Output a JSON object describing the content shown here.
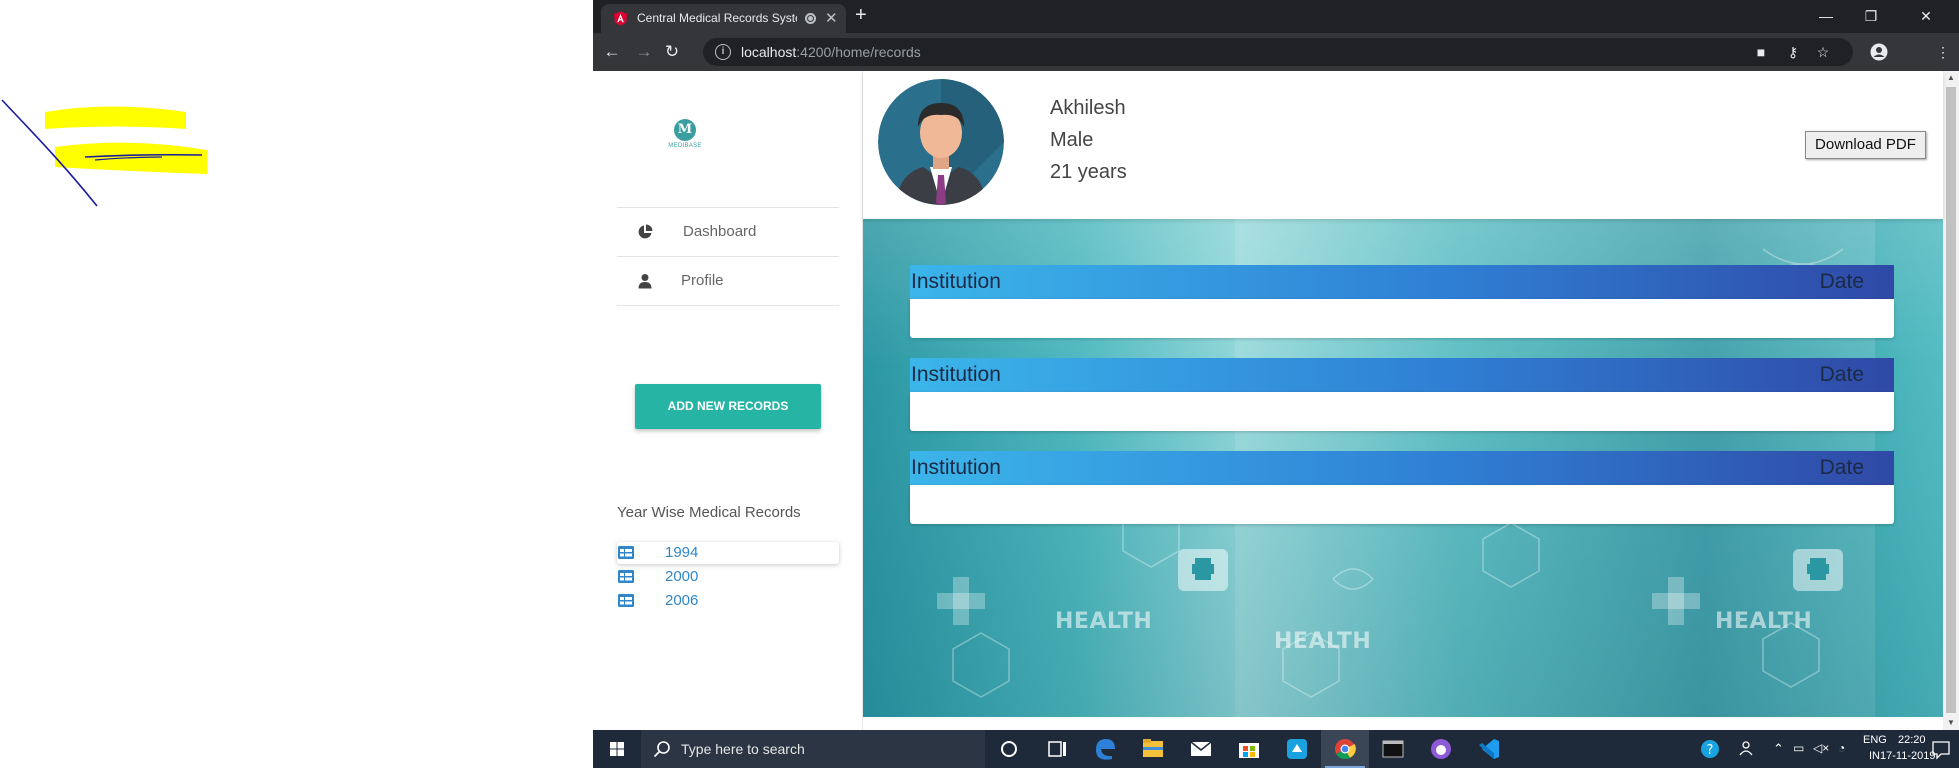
{
  "browser": {
    "tab_title": "Central Medical Records System",
    "url_host": "localhost",
    "url_path": ":4200/home/records"
  },
  "sidebar": {
    "logo_letter": "M",
    "logo_text": "MEDIBASE",
    "nav": [
      {
        "label": "Dashboard",
        "icon": "pie-chart-icon"
      },
      {
        "label": "Profile",
        "icon": "user-icon"
      }
    ],
    "add_button": "ADD NEW RECORDS",
    "years_heading": "Year Wise Medical Records",
    "years": [
      {
        "label": "1994",
        "selected": true
      },
      {
        "label": "2000",
        "selected": false
      },
      {
        "label": "2006",
        "selected": false
      }
    ]
  },
  "profile": {
    "name": "Akhilesh",
    "gender": "Male",
    "age": "21 years",
    "download_button": "Download PDF"
  },
  "hero": {
    "watermark": "HEALTH"
  },
  "records": [
    {
      "institution": "Institution",
      "date": "Date"
    },
    {
      "institution": "Institution",
      "date": "Date"
    },
    {
      "institution": "Institution",
      "date": "Date"
    }
  ],
  "taskbar": {
    "search_placeholder": "Type here to search",
    "lang_top": "ENG",
    "lang_bottom": "IN",
    "time": "22:20",
    "date": "17-11-2019"
  },
  "colors": {
    "accent": "#26b5a5",
    "record_header_start": "#3bb5ea",
    "record_header_end": "#2f49a6",
    "year_link": "#2f86c9"
  }
}
